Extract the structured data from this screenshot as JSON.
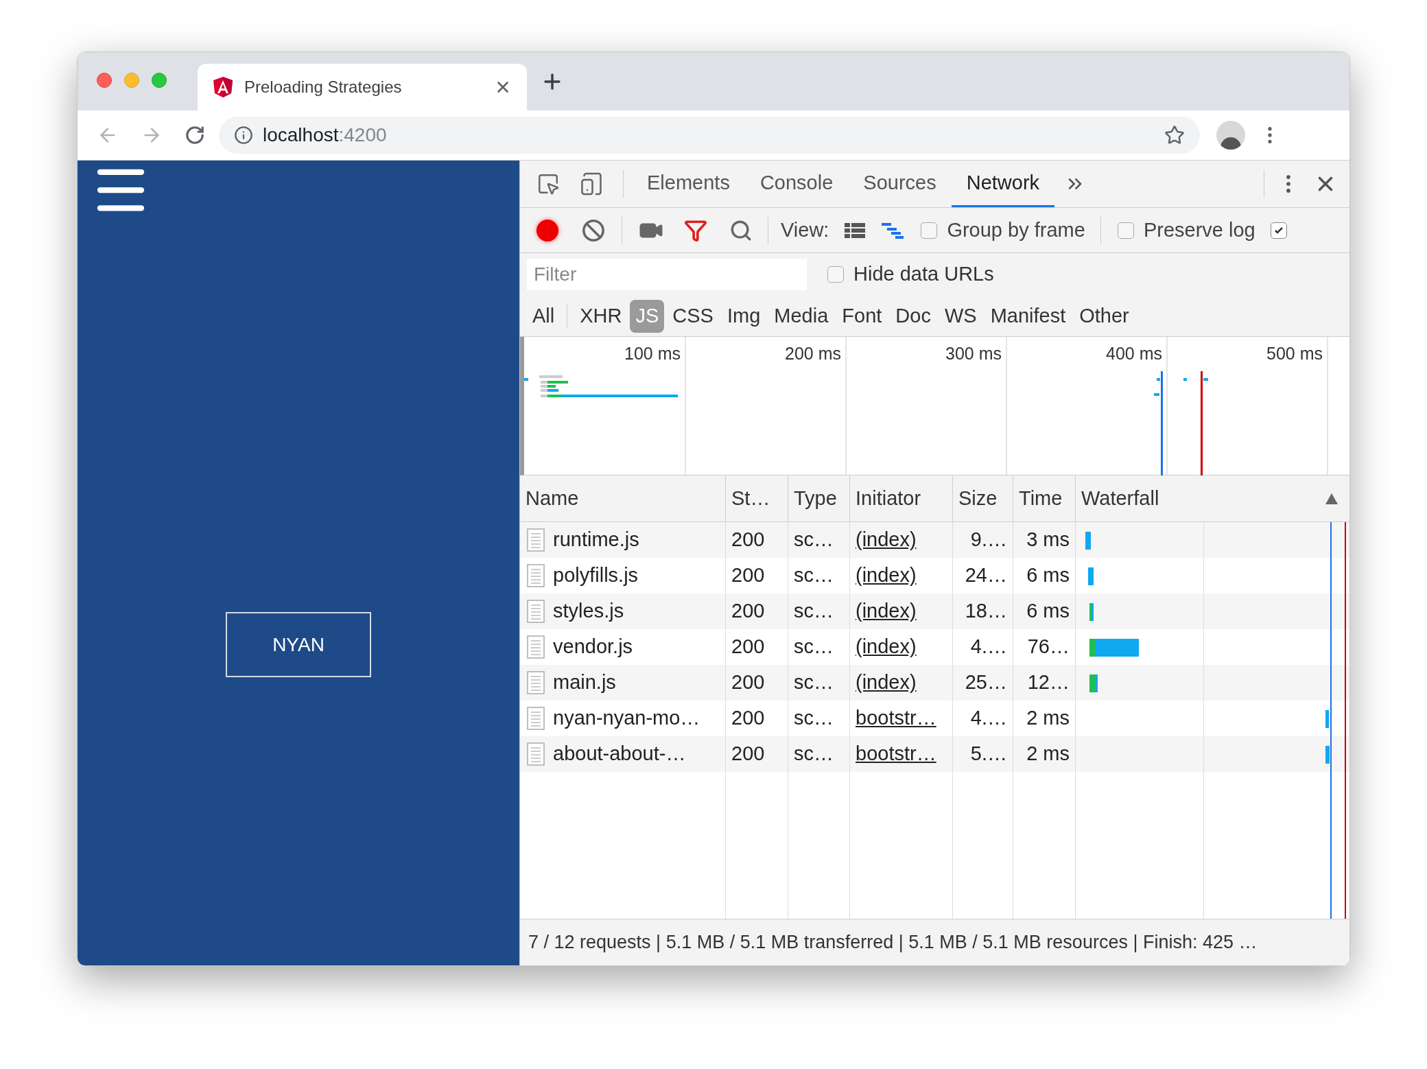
{
  "browser": {
    "tab": {
      "title": "Preloading Strategies"
    },
    "address": {
      "host": "localhost",
      "port": ":4200"
    }
  },
  "page": {
    "button": "NYAN"
  },
  "devtools": {
    "tabs": [
      {
        "label": "Elements",
        "selected": false
      },
      {
        "label": "Console",
        "selected": false
      },
      {
        "label": "Sources",
        "selected": false
      },
      {
        "label": "Network",
        "selected": true
      }
    ],
    "toolbar": {
      "recording": true,
      "view_label": "View:",
      "view_modes": [
        {
          "kind": "list",
          "selected": false
        },
        {
          "kind": "waterfall",
          "selected": true
        }
      ],
      "checkboxes": [
        {
          "label": "Group by frame",
          "checked": false
        },
        {
          "label": "Preserve log",
          "checked": false
        },
        {
          "checked": true
        }
      ]
    },
    "filter": {
      "placeholder": "Filter"
    },
    "hide_data_urls": {
      "label": "Hide data URLs",
      "checked": false
    },
    "types": [
      {
        "label": "All",
        "selected": false
      },
      {
        "label": "XHR",
        "selected": false
      },
      {
        "label": "JS",
        "selected": true
      },
      {
        "label": "CSS",
        "selected": false
      },
      {
        "label": "Img",
        "selected": false
      },
      {
        "label": "Media",
        "selected": false
      },
      {
        "label": "Font",
        "selected": false
      },
      {
        "label": "Doc",
        "selected": false
      },
      {
        "label": "WS",
        "selected": false
      },
      {
        "label": "Manifest",
        "selected": false
      },
      {
        "label": "Other",
        "selected": false
      }
    ],
    "overview": {
      "ticks": [
        "100 ms",
        "200 ms",
        "300 ms",
        "400 ms",
        "500 ms"
      ]
    },
    "table": {
      "columns": [
        {
          "label": "Name",
          "sorted": false
        },
        {
          "label": "St…",
          "sorted": false
        },
        {
          "label": "Type",
          "sorted": false
        },
        {
          "label": "Initiator",
          "sorted": false
        },
        {
          "label": "Size",
          "sorted": false
        },
        {
          "label": "Time",
          "sorted": false
        },
        {
          "label": "Waterfall",
          "sorted": true
        }
      ],
      "rows": [
        {
          "name": "runtime.js",
          "status": "200",
          "type": "sc…",
          "initiator": "(index)",
          "size": "9.…",
          "time": "3 ms"
        },
        {
          "name": "polyfills.js",
          "status": "200",
          "type": "sc…",
          "initiator": "(index)",
          "size": "24…",
          "time": "6 ms"
        },
        {
          "name": "styles.js",
          "status": "200",
          "type": "sc…",
          "initiator": "(index)",
          "size": "18…",
          "time": "6 ms"
        },
        {
          "name": "vendor.js",
          "status": "200",
          "type": "sc…",
          "initiator": "(index)",
          "size": "4.…",
          "time": "76…"
        },
        {
          "name": "main.js",
          "status": "200",
          "type": "sc…",
          "initiator": "(index)",
          "size": "25…",
          "time": "12…"
        },
        {
          "name": "nyan-nyan-mo…",
          "status": "200",
          "type": "sc…",
          "initiator": "bootstr…",
          "size": "4.…",
          "time": "2 ms"
        },
        {
          "name": "about-about-…",
          "status": "200",
          "type": "sc…",
          "initiator": "bootstr…",
          "size": "5.…",
          "time": "2 ms"
        }
      ]
    },
    "status_bar": "7 / 12 requests | 5.1 MB / 5.1 MB transferred | 5.1 MB / 5.1 MB resources | Finish: 425 …"
  }
}
